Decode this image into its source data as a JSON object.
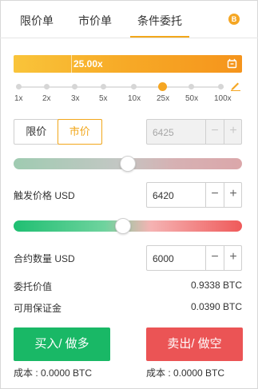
{
  "tabs": {
    "limit": "限价单",
    "market": "市价单",
    "conditional": "条件委托",
    "coin_badge": "B"
  },
  "leverage": {
    "value": "25.00x",
    "ticks": [
      "1x",
      "2x",
      "3x",
      "5x",
      "10x",
      "25x",
      "50x",
      "100x"
    ],
    "selected_index": 5,
    "bar_icon": "calculator-icon",
    "edit_icon": "pencil-icon"
  },
  "order_type": {
    "limit_label": "限价",
    "market_label": "市价",
    "active": "market"
  },
  "price_input": {
    "value": "6425",
    "minus": "−",
    "plus": "+"
  },
  "trigger": {
    "label": "触发价格",
    "unit": "USD",
    "value": "6420",
    "minus": "−",
    "plus": "+"
  },
  "ratio_slider_top": {
    "level": 0.5
  },
  "ratio_slider_bottom": {
    "level": 0.48
  },
  "quantity": {
    "label": "合约数量",
    "unit": "USD",
    "value": "6000",
    "minus": "−",
    "plus": "+"
  },
  "summary": {
    "order_value_label": "委托价值",
    "order_value": "0.9338 BTC",
    "margin_label": "可用保证金",
    "margin": "0.0390 BTC"
  },
  "actions": {
    "buy_label": "买入/ 做多",
    "sell_label": "卖出/ 做空",
    "buy_cost": "成本 : 0.0000 BTC",
    "sell_cost": "成本 : 0.0000 BTC"
  },
  "colors": {
    "accent": "#f2a71b",
    "buy": "#19b866",
    "sell": "#eb5455"
  }
}
